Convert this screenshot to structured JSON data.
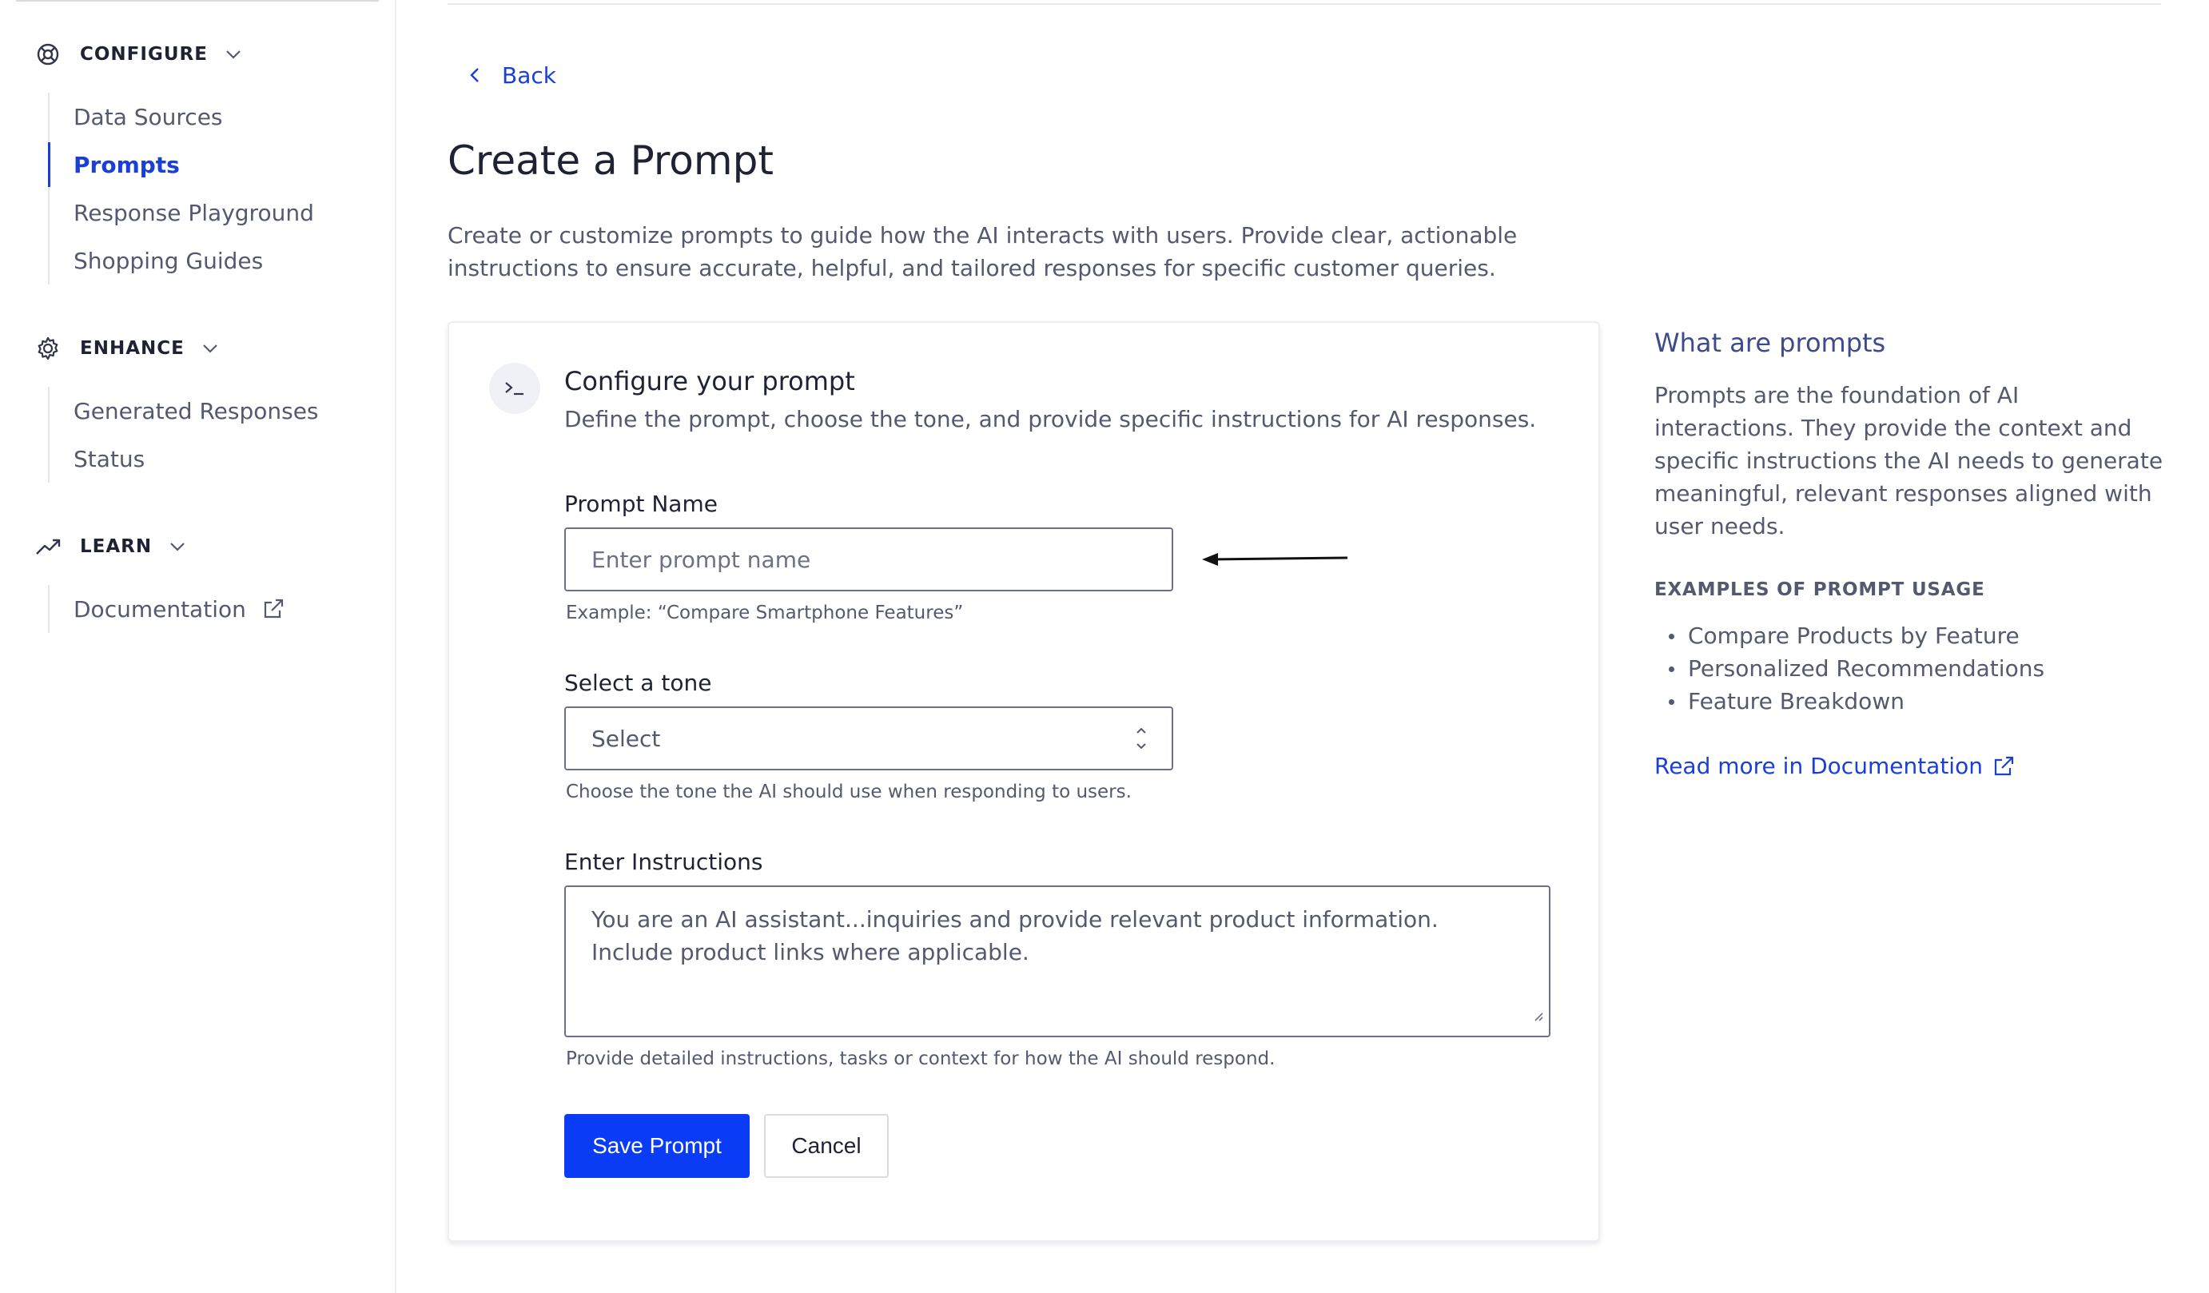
{
  "sidebar": {
    "groups": [
      {
        "label": "CONFIGURE",
        "items": [
          {
            "label": "Data Sources"
          },
          {
            "label": "Prompts"
          },
          {
            "label": "Response Playground"
          },
          {
            "label": "Shopping Guides"
          }
        ]
      },
      {
        "label": "ENHANCE",
        "items": [
          {
            "label": "Generated Responses"
          },
          {
            "label": "Status"
          }
        ]
      },
      {
        "label": "LEARN",
        "items": [
          {
            "label": "Documentation"
          }
        ]
      }
    ],
    "active_item": "Prompts"
  },
  "main": {
    "back_label": "Back",
    "title": "Create a Prompt",
    "description": "Create or customize prompts to guide how the AI interacts with users. Provide clear, actionable instructions to ensure accurate, helpful, and tailored responses for specific customer queries."
  },
  "form": {
    "title": "Configure your prompt",
    "subtitle": "Define the prompt, choose the tone, and provide specific instructions for AI responses.",
    "name_label": "Prompt Name",
    "name_placeholder": "Enter prompt name",
    "name_helper": "Example: “Compare Smartphone Features”",
    "tone_label": "Select a tone",
    "tone_value": "Select",
    "tone_helper": "Choose the tone the AI should use when responding to users.",
    "instructions_label": "Enter Instructions",
    "instructions_value": "You are an AI assistant...inquiries  and provide relevant product information. Include product links where applicable.",
    "instructions_helper": "Provide detailed instructions, tasks or context for how the AI should respond.",
    "save_label": "Save Prompt",
    "cancel_label": "Cancel"
  },
  "help": {
    "title": "What are prompts",
    "body": "Prompts are the foundation of AI interactions. They provide the context and specific instructions the AI needs to generate meaningful, relevant responses aligned with user needs.",
    "examples_heading": "EXAMPLES OF PROMPT USAGE",
    "examples": [
      "Compare Products by Feature",
      "Personalized Recommendations",
      "Feature Breakdown"
    ],
    "link_label": "Read more in Documentation"
  },
  "colors": {
    "accent": "#1a3fd6",
    "primary_button": "#0b3cf5",
    "help_title": "#3e4a8c"
  }
}
